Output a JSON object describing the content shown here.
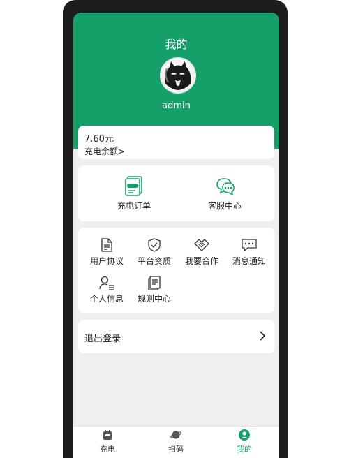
{
  "profile": {
    "title": "我的",
    "username": "admin"
  },
  "balance": {
    "amount": "7.60元",
    "label": "充电余额>"
  },
  "quick_actions": [
    {
      "label": "充电订单",
      "icon": "charge-order-icon"
    },
    {
      "label": "客服中心",
      "icon": "chat-bubbles-icon"
    }
  ],
  "services": [
    {
      "label": "用户协议",
      "icon": "document-icon"
    },
    {
      "label": "平台资质",
      "icon": "shield-check-icon"
    },
    {
      "label": "我要合作",
      "icon": "handshake-icon"
    },
    {
      "label": "消息通知",
      "icon": "message-icon"
    },
    {
      "label": "个人信息",
      "icon": "user-list-icon"
    },
    {
      "label": "规则中心",
      "icon": "rules-icon"
    }
  ],
  "logout": {
    "label": "退出登录"
  },
  "tabs": [
    {
      "label": "充电",
      "icon": "charging-icon",
      "active": false
    },
    {
      "label": "扫码",
      "icon": "planet-icon",
      "active": false
    },
    {
      "label": "我的",
      "icon": "user-icon",
      "active": true
    }
  ],
  "colors": {
    "brand": "#15a06a",
    "background": "#efefef"
  }
}
